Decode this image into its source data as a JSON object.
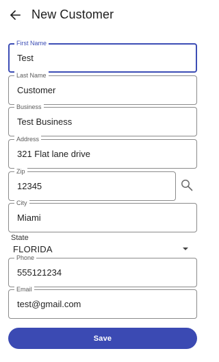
{
  "header": {
    "title": "New Customer",
    "back_icon": "arrow-left-icon"
  },
  "form": {
    "first_name": {
      "label": "First Name",
      "value": "Test"
    },
    "last_name": {
      "label": "Last Name",
      "value": "Customer"
    },
    "business": {
      "label": "Business",
      "value": "Test Business"
    },
    "address": {
      "label": "Address",
      "value": "321 Flat lane drive"
    },
    "zip": {
      "label": "Zip",
      "value": "12345"
    },
    "city": {
      "label": "City",
      "value": "Miami"
    },
    "state": {
      "label": "State",
      "value": "FLORIDA"
    },
    "phone": {
      "label": "Phone",
      "value": "555121234"
    },
    "email": {
      "label": "Email",
      "value": "test@gmail.com"
    }
  },
  "actions": {
    "save_label": "Save",
    "search_icon": "search-icon"
  },
  "colors": {
    "accent": "#3b4ab3",
    "border": "#8a8a8a"
  }
}
